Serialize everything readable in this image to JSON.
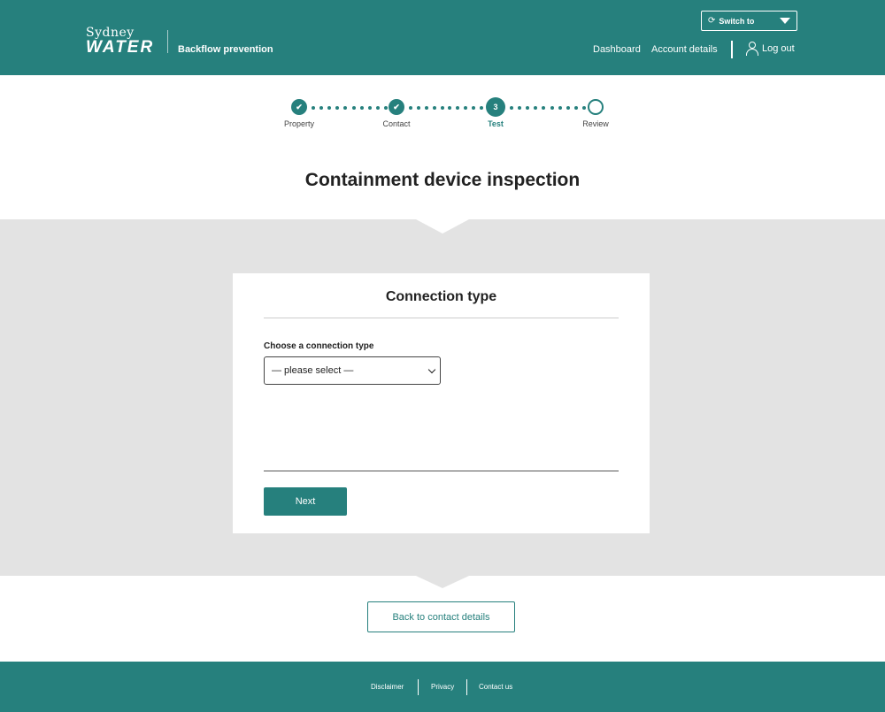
{
  "header": {
    "brand_top": "Sydney",
    "brand_bottom": "WATER",
    "app_name": "Backflow prevention",
    "switch_label": "Switch to",
    "nav": {
      "dashboard": "Dashboard",
      "account": "Account details",
      "logout": "Log out"
    }
  },
  "stepper": {
    "steps": [
      {
        "label": "Property",
        "state": "done",
        "mark": "✔"
      },
      {
        "label": "Contact",
        "state": "done",
        "mark": "✔"
      },
      {
        "label": "Test",
        "state": "current",
        "mark": "3"
      },
      {
        "label": "Review",
        "state": "todo",
        "mark": ""
      }
    ]
  },
  "page": {
    "title": "Containment device inspection"
  },
  "card": {
    "title": "Connection type",
    "field_label": "Choose a connection type",
    "select_value": "— please select —",
    "next_label": "Next"
  },
  "back_label": "Back to contact details",
  "footer": {
    "links": [
      "Disclaimer",
      "Privacy",
      "Contact us"
    ]
  },
  "colors": {
    "brand": "#26807d",
    "band": "#e3e3e3"
  }
}
